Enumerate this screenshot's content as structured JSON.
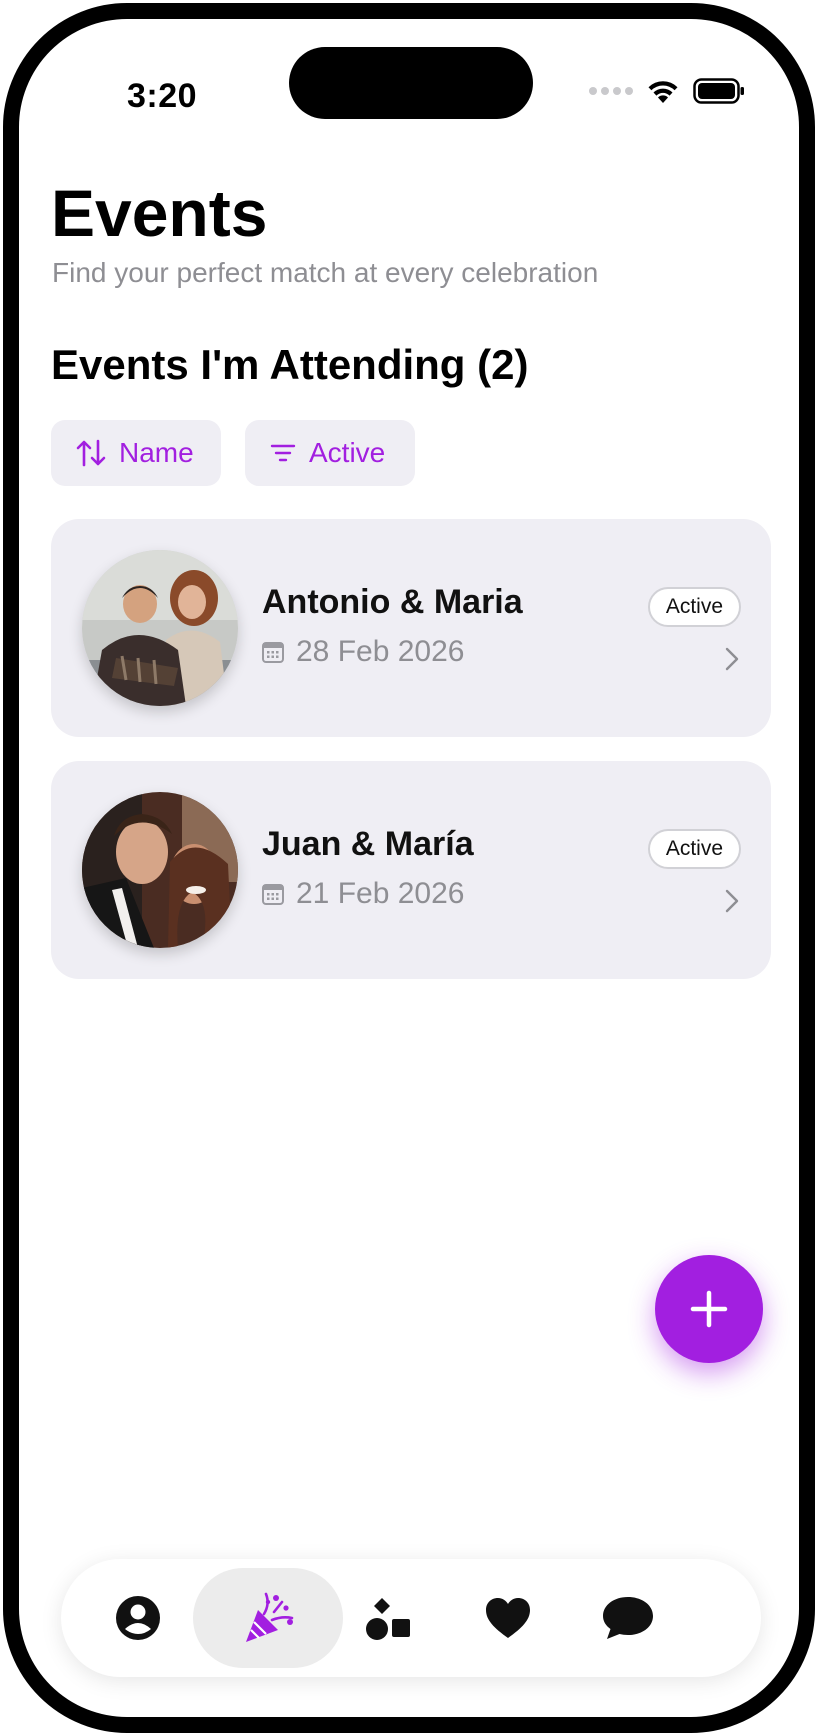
{
  "status": {
    "time": "3:20"
  },
  "header": {
    "title": "Events",
    "subtitle": "Find your perfect match at every celebration"
  },
  "section": {
    "title": "Events I'm Attending (2)"
  },
  "filters": {
    "sort_label": "Name",
    "filter_label": "Active"
  },
  "events": [
    {
      "name": "Antonio & Maria",
      "date": "28 Feb 2026",
      "status": "Active"
    },
    {
      "name": "Juan & María",
      "date": "21 Feb 2026",
      "status": "Active"
    }
  ],
  "tabbar": {
    "items": [
      "profile-icon",
      "party-popper-icon",
      "shapes-icon",
      "heart-icon",
      "chat-bubble-icon"
    ],
    "active_index": 1
  },
  "colors": {
    "accent": "#a21fe0",
    "card_bg": "#efeef4",
    "muted_text": "#8e8e93"
  }
}
